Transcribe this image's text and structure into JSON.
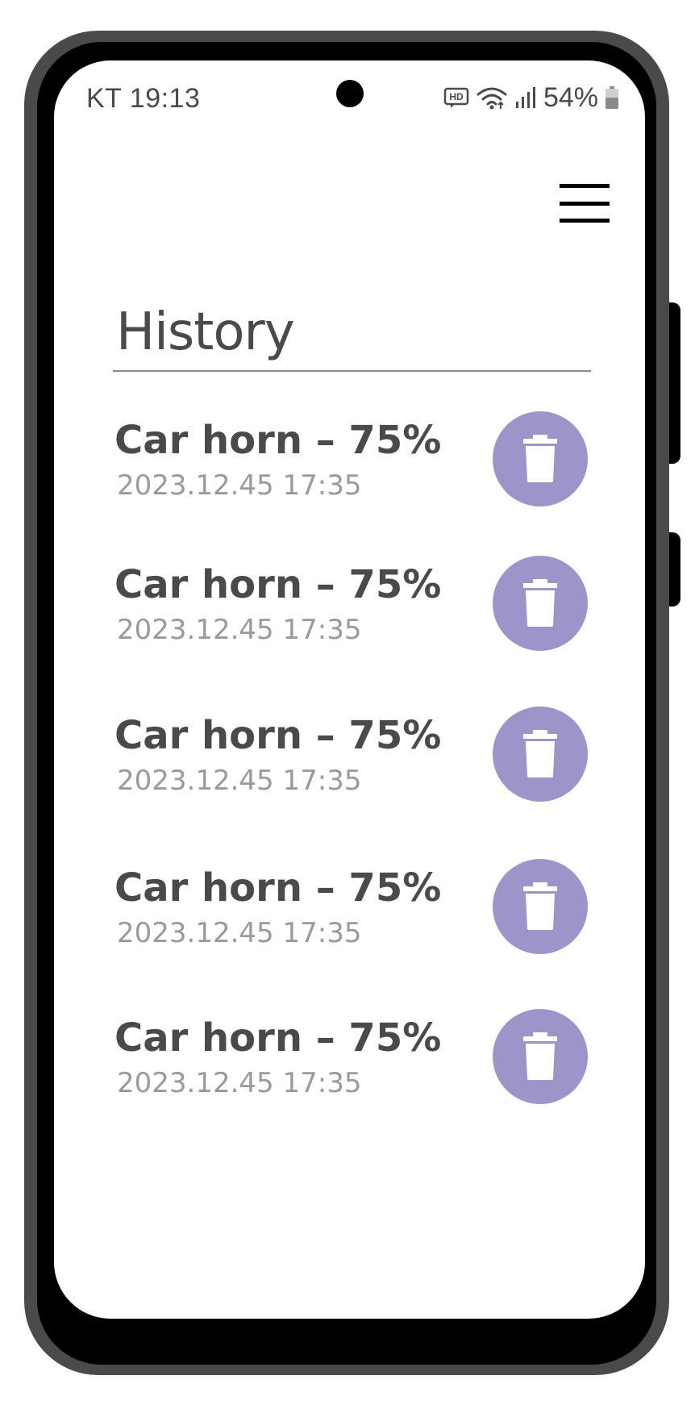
{
  "status_bar": {
    "carrier_time": "KT 19:13",
    "hd_label": "HD",
    "battery_percent": "54%"
  },
  "header": {
    "menu_icon": "hamburger-menu-icon",
    "title": "History"
  },
  "colors": {
    "accent": "#9c95c9",
    "title_text": "#4a4a4a",
    "subtle_text": "#9a9a9a"
  },
  "history": {
    "items": [
      {
        "title": "Car horn – 75%",
        "time": "2023.12.45 17:35",
        "icon": "trash-icon"
      },
      {
        "title": "Car horn – 75%",
        "time": "2023.12.45 17:35",
        "icon": "trash-icon"
      },
      {
        "title": "Car horn – 75%",
        "time": "2023.12.45 17:35",
        "icon": "trash-icon"
      },
      {
        "title": "Car horn – 75%",
        "time": "2023.12.45 17:35",
        "icon": "trash-icon"
      },
      {
        "title": "Car horn – 75%",
        "time": "2023.12.45 17:35",
        "icon": "trash-icon"
      }
    ]
  }
}
